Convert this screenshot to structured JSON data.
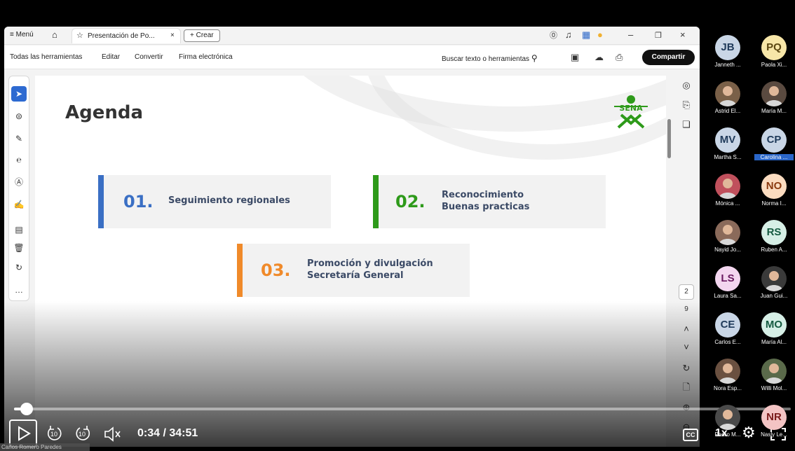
{
  "titlebar": {
    "menu_label": "Menú",
    "tab_label": "Presentación de Po...",
    "tab_close": "×",
    "new_button": "+ Crear"
  },
  "toolbar": {
    "items": [
      "Todas las herramientas",
      "Editar",
      "Convertir",
      "Firma electrónica"
    ],
    "search_label": "Buscar texto o herramientas",
    "share_label": "Compartir"
  },
  "slide": {
    "title": "Agenda",
    "logo_text": "SENA",
    "items": [
      {
        "number": "01.",
        "line1": "Seguimiento regionales",
        "line2": "",
        "accent": "#3a6fc4"
      },
      {
        "number": "02.",
        "line1": "Reconocimiento",
        "line2": "Buenas practicas",
        "accent": "#2e9a1a"
      },
      {
        "number": "03.",
        "line1": "Promoción y divulgación",
        "line2": "Secretaría General",
        "accent": "#f08a2a"
      }
    ]
  },
  "page_nav": {
    "current_page": "2",
    "total_pages": "9"
  },
  "player": {
    "time": "0:34 / 34:51",
    "speed": "1x",
    "cc": "CC",
    "skip_back": "10",
    "skip_fwd": "10",
    "presenter": "Carlos Romero Paredes",
    "progress_fraction": 0.0163
  },
  "participants": [
    {
      "initials": "JB",
      "name": "Janneth ...",
      "bg": "#c9d6e6",
      "fg": "#1f3a5a",
      "photo": false
    },
    {
      "initials": "PQ",
      "name": "Paola Xi...",
      "bg": "#f7e6a8",
      "fg": "#5a4510",
      "photo": false
    },
    {
      "initials": "",
      "name": "Astrid El...",
      "bg": "#7a6048",
      "fg": "#fff",
      "photo": true
    },
    {
      "initials": "",
      "name": "María M...",
      "bg": "#5a4a40",
      "fg": "#fff",
      "photo": true
    },
    {
      "initials": "MV",
      "name": "Martha S...",
      "bg": "#c9d6e6",
      "fg": "#1f3a5a",
      "photo": false
    },
    {
      "initials": "CP",
      "name": "Carolina ...",
      "bg": "#c9d6e6",
      "fg": "#1f3a5a",
      "photo": false,
      "highlight": true
    },
    {
      "initials": "",
      "name": "Mónica ...",
      "bg": "#c0505c",
      "fg": "#fff",
      "photo": true
    },
    {
      "initials": "NO",
      "name": "Norma I...",
      "bg": "#fbdcc0",
      "fg": "#8a3a10",
      "photo": false
    },
    {
      "initials": "",
      "name": "Nayid Jo...",
      "bg": "#8a6a5a",
      "fg": "#fff",
      "photo": true
    },
    {
      "initials": "RS",
      "name": "Ruben A...",
      "bg": "#d6efe6",
      "fg": "#145a40",
      "photo": false
    },
    {
      "initials": "LS",
      "name": "Laura Sa...",
      "bg": "#f3d6ef",
      "fg": "#6a1a60",
      "photo": false
    },
    {
      "initials": "",
      "name": "Juan Gui...",
      "bg": "#3a3a3a",
      "fg": "#fff",
      "photo": true
    },
    {
      "initials": "CE",
      "name": "Carlos E...",
      "bg": "#c9d6e6",
      "fg": "#1f3a5a",
      "photo": false
    },
    {
      "initials": "MO",
      "name": "María Al...",
      "bg": "#d6efe6",
      "fg": "#145a40",
      "photo": false
    },
    {
      "initials": "",
      "name": "Nora Esp...",
      "bg": "#6a5040",
      "fg": "#fff",
      "photo": true
    },
    {
      "initials": "",
      "name": "Willi Mol...",
      "bg": "#5a6a4a",
      "fg": "#fff",
      "photo": true
    },
    {
      "initials": "",
      "name": "Pedro M...",
      "bg": "#4a4a4a",
      "fg": "#fff",
      "photo": true
    },
    {
      "initials": "NR",
      "name": "Nasly Le...",
      "bg": "#f3c4c4",
      "fg": "#7a1a1a",
      "photo": false
    }
  ]
}
